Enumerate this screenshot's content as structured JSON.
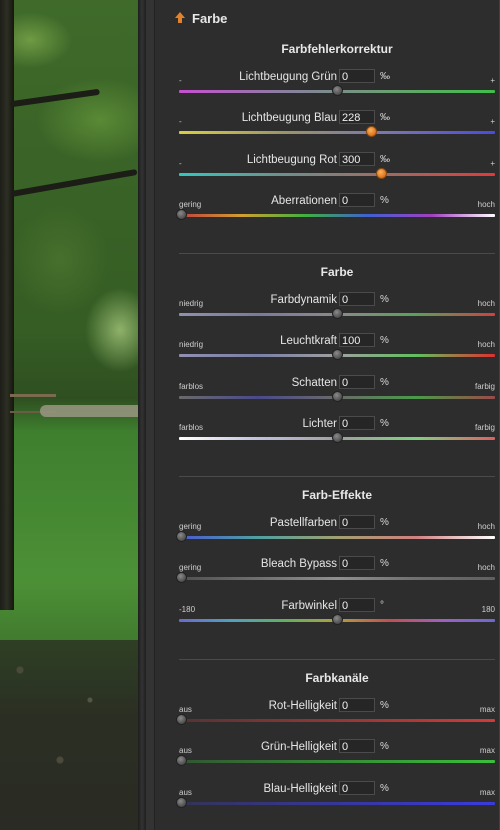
{
  "panel": {
    "header": "Farbe",
    "icon": "arrow-up-icon",
    "accent": "#e0832a"
  },
  "sections": [
    {
      "title": "Farbfehlerkorrektur",
      "sliders": [
        {
          "label": "Lichtbeugung Grün",
          "value": "0",
          "unit": "‰",
          "min_label": "-",
          "max_label": "+",
          "position": 0.5,
          "active": false
        },
        {
          "label": "Lichtbeugung Blau",
          "value": "228",
          "unit": "‰",
          "min_label": "-",
          "max_label": "+",
          "position": 0.61,
          "active": true
        },
        {
          "label": "Lichtbeugung Rot",
          "value": "300",
          "unit": "‰",
          "min_label": "-",
          "max_label": "+",
          "position": 0.64,
          "active": true
        },
        {
          "label": "Aberrationen",
          "value": "0",
          "unit": "%",
          "min_label": "gering",
          "max_label": "hoch",
          "position": 0.0,
          "active": false
        }
      ]
    },
    {
      "title": "Farbe",
      "sliders": [
        {
          "label": "Farbdynamik",
          "value": "0",
          "unit": "%",
          "min_label": "niedrig",
          "max_label": "hoch",
          "position": 0.5,
          "active": false
        },
        {
          "label": "Leuchtkraft",
          "value": "100",
          "unit": "%",
          "min_label": "niedrig",
          "max_label": "hoch",
          "position": 0.5,
          "active": false
        },
        {
          "label": "Schatten",
          "value": "0",
          "unit": "%",
          "min_label": "farblos",
          "max_label": "farbig",
          "position": 0.5,
          "active": false
        },
        {
          "label": "Lichter",
          "value": "0",
          "unit": "%",
          "min_label": "farblos",
          "max_label": "farbig",
          "position": 0.5,
          "active": false
        }
      ]
    },
    {
      "title": "Farb-Effekte",
      "sliders": [
        {
          "label": "Pastellfarben",
          "value": "0",
          "unit": "%",
          "min_label": "gering",
          "max_label": "hoch",
          "position": 0.0,
          "active": false
        },
        {
          "label": "Bleach Bypass",
          "value": "0",
          "unit": "%",
          "min_label": "gering",
          "max_label": "hoch",
          "position": 0.0,
          "active": false
        },
        {
          "label": "Farbwinkel",
          "value": "0",
          "unit": "°",
          "min_label": "-180",
          "max_label": "180",
          "position": 0.5,
          "active": false
        }
      ]
    },
    {
      "title": "Farbkanäle",
      "sliders": [
        {
          "label": "Rot-Helligkeit",
          "value": "0",
          "unit": "%",
          "min_label": "aus",
          "max_label": "max",
          "position": 0.0,
          "active": false
        },
        {
          "label": "Grün-Helligkeit",
          "value": "0",
          "unit": "%",
          "min_label": "aus",
          "max_label": "max",
          "position": 0.0,
          "active": false
        },
        {
          "label": "Blau-Helligkeit",
          "value": "0",
          "unit": "%",
          "min_label": "aus",
          "max_label": "max",
          "position": 0.0,
          "active": false
        }
      ]
    }
  ],
  "track_colors": {
    "lichtbeugung_gruen": [
      "#c84fd0",
      "#8a7fa0",
      "#6aa070",
      "#3fbf4a"
    ],
    "lichtbeugung_blau": [
      "#d8d040",
      "#9a9468",
      "#7a74b0",
      "#4a4ae0"
    ],
    "lichtbeugung_rot": [
      "#30c8c0",
      "#6f8f8c",
      "#a06a62",
      "#e03a3a"
    ],
    "aberrationen": [
      "#c04040",
      "#d0a030",
      "#40b040",
      "#4060d0",
      "#a040c0",
      "#ffffff"
    ],
    "farbdynamik": [
      "#9090b0",
      "#7a7aa0",
      "#8a8a8a",
      "#5aa05a",
      "#d04040"
    ],
    "leuchtkraft": [
      "#9090b0",
      "#7a80a8",
      "#a0a0a0",
      "#60c060",
      "#e03030"
    ],
    "schatten": [
      "#6a6a6a",
      "#4a4a8a",
      "#6a6a6a",
      "#4a9a4a",
      "#9a4a4a"
    ],
    "lichter": [
      "#ffffff",
      "#c0c0e0",
      "#a0a0a0",
      "#80d080",
      "#e06060"
    ],
    "pastellfarben": [
      "#4a5ad0",
      "#50a0a0",
      "#a0a070",
      "#d08080",
      "#ffffff"
    ],
    "bleach_bypass": [
      "#505050",
      "#707070",
      "#909090",
      "#707070",
      "#606060"
    ],
    "farbwinkel": [
      "#6a6ad0",
      "#50a0c0",
      "#60b060",
      "#b0a040",
      "#c05050",
      "#a060c0",
      "#6a6ad0"
    ],
    "rot_helligkeit": [
      "#553333",
      "#d03a3a"
    ],
    "gruen_helligkeit": [
      "#335533",
      "#3ac03a"
    ],
    "blau_helligkeit": [
      "#333355",
      "#3a3ae0"
    ]
  }
}
